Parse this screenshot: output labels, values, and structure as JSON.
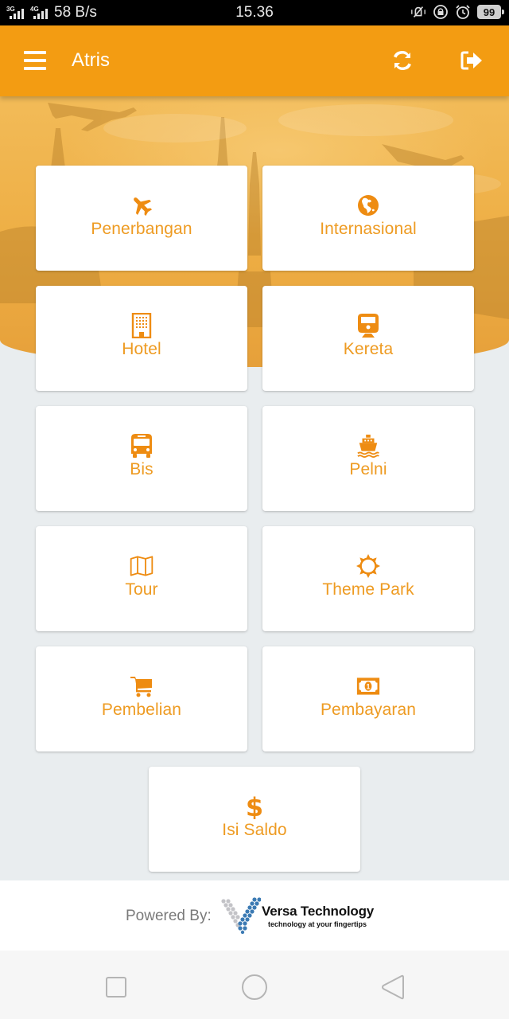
{
  "status_bar": {
    "signal1_label": "3G",
    "signal2_label": "4G",
    "net_speed": "58 B/s",
    "time": "15.36",
    "icons": [
      "vibrate-silent-icon",
      "rotation-lock-icon",
      "alarm-icon"
    ],
    "battery": "99"
  },
  "app_bar": {
    "title": "Atris",
    "menu_icon": "hamburger-menu-icon",
    "actions": [
      {
        "name": "refresh",
        "icon": "refresh-icon"
      },
      {
        "name": "logout",
        "icon": "sign-out-icon"
      }
    ]
  },
  "theme": {
    "primary": "#f39c12",
    "accent_text": "#ee9b22",
    "background": "#e9edef",
    "card": "#ffffff"
  },
  "menu": {
    "items": [
      {
        "label": "Penerbangan",
        "icon": "plane-icon"
      },
      {
        "label": "Internasional",
        "icon": "globe-icon"
      },
      {
        "label": "Hotel",
        "icon": "building-icon"
      },
      {
        "label": "Kereta",
        "icon": "train-icon"
      },
      {
        "label": "Bis",
        "icon": "bus-icon"
      },
      {
        "label": "Pelni",
        "icon": "ship-icon"
      },
      {
        "label": "Tour",
        "icon": "map-icon"
      },
      {
        "label": "Theme Park",
        "icon": "sun-icon"
      },
      {
        "label": "Pembelian",
        "icon": "shopping-cart-icon"
      },
      {
        "label": "Pembayaran",
        "icon": "money-bill-icon"
      },
      {
        "label": "Isi Saldo",
        "icon": "dollar-icon"
      }
    ]
  },
  "footer": {
    "powered_by": "Powered By:",
    "brand_name": "Versa Technology",
    "brand_tagline": "technology at your fingertips"
  },
  "nav_bar": {
    "buttons": [
      "recent-apps",
      "home",
      "back"
    ]
  }
}
